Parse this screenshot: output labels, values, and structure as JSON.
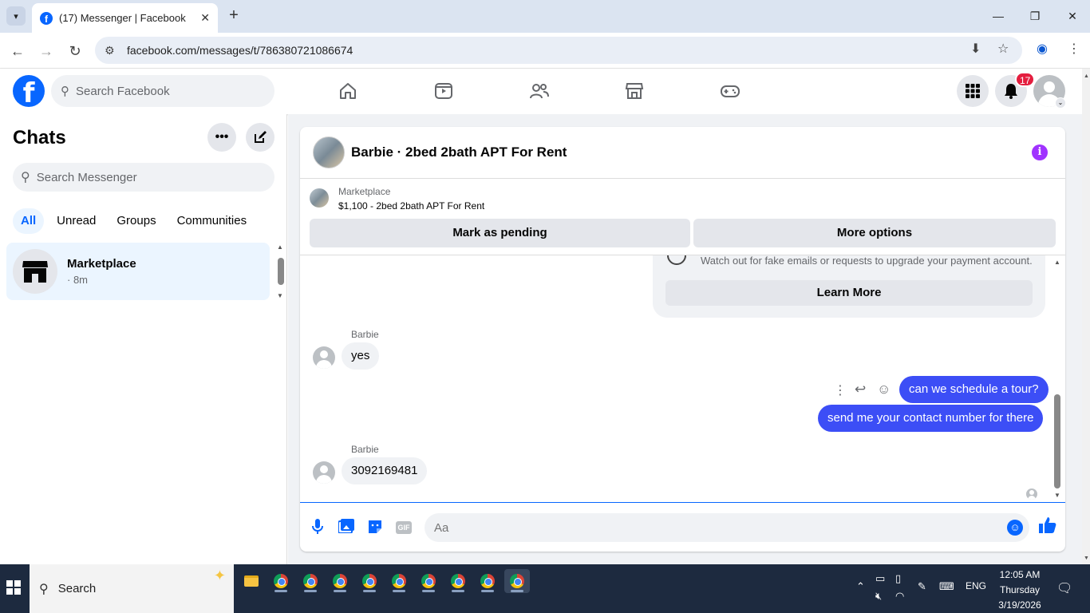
{
  "browser": {
    "tab_title": "(17) Messenger | Facebook",
    "url": "facebook.com/messages/t/786380721086674"
  },
  "fb": {
    "search_placeholder": "Search Facebook",
    "notification_count": "17",
    "brand_color": "#0866ff"
  },
  "left": {
    "title": "Chats",
    "search_placeholder": "Search Messenger",
    "filters": [
      "All",
      "Unread",
      "Groups",
      "Communities"
    ],
    "chat": {
      "name": "Marketplace",
      "time": "· 8m"
    }
  },
  "conversation": {
    "title": "Barbie · 2bed 2bath APT For Rent",
    "listing": {
      "category": "Marketplace",
      "price_title": "$1,100 - 2bed 2bath APT For Rent",
      "mark_pending": "Mark as pending",
      "more_options": "More options"
    },
    "safety": {
      "text": "Watch out for fake emails or requests to upgrade your payment account.",
      "learn_more": "Learn More"
    },
    "messages": [
      {
        "sender": "Barbie",
        "text": "yes"
      },
      {
        "text": "can we schedule a tour?"
      },
      {
        "text": "send me your contact number for there"
      },
      {
        "sender": "Barbie",
        "text": "3092169481"
      }
    ],
    "composer_placeholder": "Aa",
    "outgoing_color": "#3c4ef6"
  },
  "taskbar": {
    "search_label": "Search",
    "language": "ENG",
    "time": "12:05 AM",
    "day": "Thursday",
    "date": "3/19/2026"
  }
}
